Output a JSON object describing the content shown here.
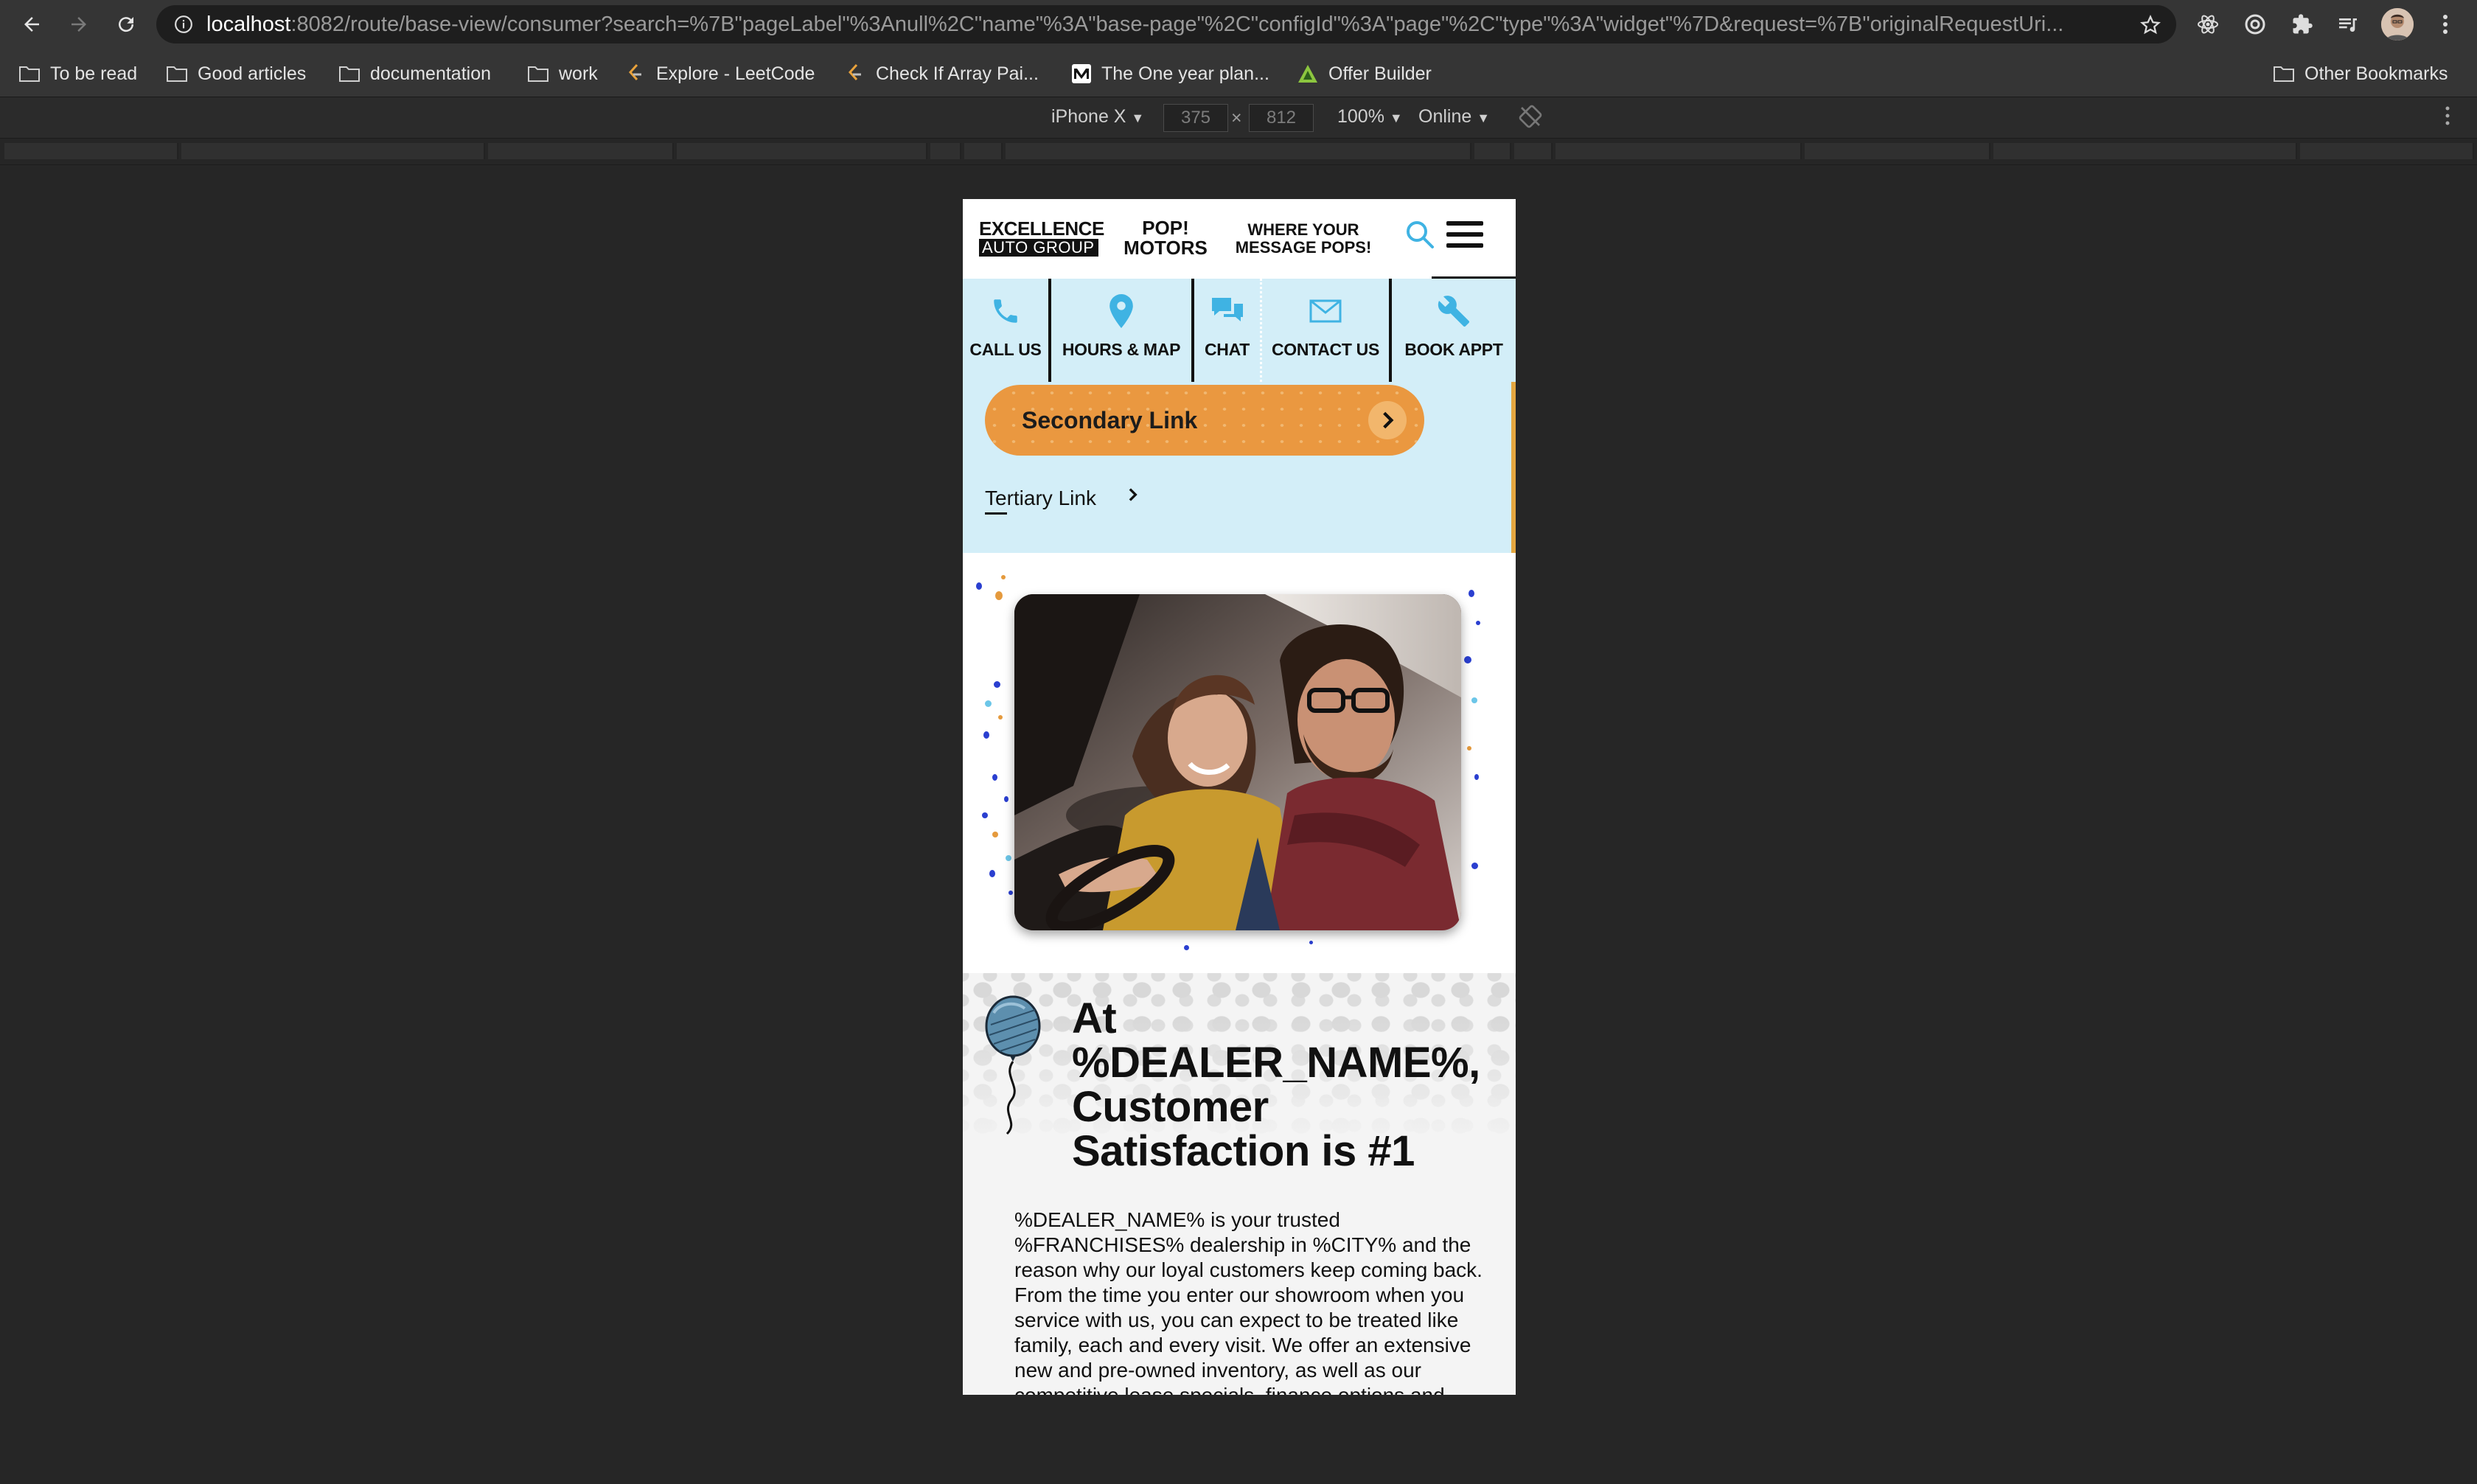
{
  "browser": {
    "url_host": "localhost",
    "url_rest": ":8082/route/base-view/consumer?search=%7B\"pageLabel\"%3Anull%2C\"name\"%3A\"base-page\"%2C\"configId\"%3A\"page\"%2C\"type\"%3A\"widget\"%7D&request=%7B\"originalRequestUri..."
  },
  "bookmarks": {
    "items": [
      {
        "label": "To be read",
        "icon": "folder-icon"
      },
      {
        "label": "Good articles",
        "icon": "folder-icon"
      },
      {
        "label": "documentation",
        "icon": "folder-icon"
      },
      {
        "label": "work",
        "icon": "folder-icon"
      },
      {
        "label": "Explore - LeetCode",
        "icon": "leetcode-icon"
      },
      {
        "label": "Check If Array Pai...",
        "icon": "leetcode-icon"
      },
      {
        "label": "The One year plan...",
        "icon": "medium-icon"
      },
      {
        "label": "Offer Builder",
        "icon": "offer-builder-icon"
      }
    ],
    "other": "Other Bookmarks"
  },
  "devtools": {
    "device": "iPhone X",
    "width": "375",
    "height": "812",
    "times": "×",
    "zoom": "100%",
    "network": "Online"
  },
  "site": {
    "logo_line1": "EXCELLENCE",
    "logo_line2": "AUTO GROUP",
    "brand_line1": "POP!",
    "brand_line2": "MOTORS",
    "tagline_line1": "WHERE YOUR",
    "tagline_line2": "MESSAGE POPS!",
    "quicknav": [
      {
        "label": "CALL US",
        "icon": "phone-icon"
      },
      {
        "label": "HOURS & MAP",
        "icon": "map-pin-icon"
      },
      {
        "label": "CHAT",
        "icon": "chat-icon"
      },
      {
        "label": "CONTACT US",
        "icon": "mail-icon"
      },
      {
        "label": "BOOK APPT",
        "icon": "wrench-icon"
      }
    ],
    "secondary_link": "Secondary Link",
    "tertiary_link": "Tertiary Link",
    "heading": "At %DEALER_NAME%, Customer Satisfaction is #1",
    "body": "%DEALER_NAME% is your trusted %FRANCHISES% dealership in %CITY% and the reason why our loyal customers keep coming back. From the time you enter our showroom when you service with us, you can expect to be treated like family, each and every visit. We offer an extensive new and pre-owned inventory, as well as our competitive lease specials, finance options and expert auto service. We are"
  },
  "colors": {
    "accent_blue": "#3fb3e3",
    "nav_bg": "#d3eef8",
    "secondary_button": "#ea9840"
  }
}
